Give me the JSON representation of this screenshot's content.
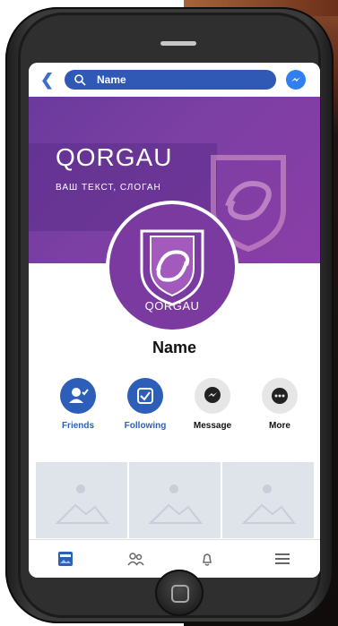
{
  "app": {
    "page_title": "Name"
  },
  "search": {
    "value": "Name"
  },
  "banner": {
    "brand_name": "QORGAU",
    "slogan": "ВАШ ТЕКСТ, СЛОГАН"
  },
  "profile": {
    "avatar_text": "QORGAU",
    "name": "Name"
  },
  "actions": [
    {
      "label": "Friends",
      "icon": "add-friend-icon",
      "style": "primary"
    },
    {
      "label": "Following",
      "icon": "following-check-icon",
      "style": "primary"
    },
    {
      "label": "Message",
      "icon": "messenger-icon",
      "style": "secondary"
    },
    {
      "label": "More",
      "icon": "more-dots-icon",
      "style": "secondary"
    }
  ],
  "photos": [
    {
      "icon": "image-placeholder-icon"
    },
    {
      "icon": "image-placeholder-icon"
    },
    {
      "icon": "image-placeholder-icon"
    }
  ],
  "bottom_nav": [
    {
      "icon": "feed-icon"
    },
    {
      "icon": "friends-icon"
    },
    {
      "icon": "bell-icon"
    },
    {
      "icon": "menu-icon"
    }
  ],
  "colors": {
    "accent": "#2e5fb8",
    "brand": "#7b3aa0"
  }
}
